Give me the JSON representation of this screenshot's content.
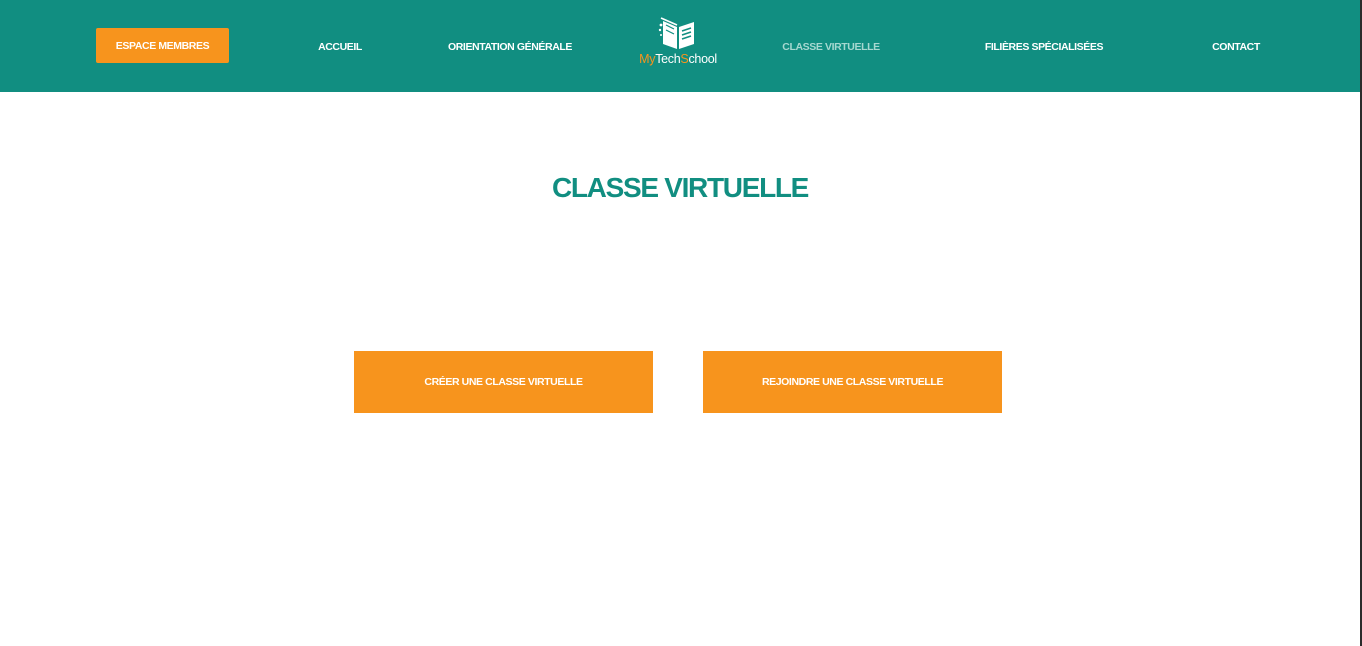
{
  "header": {
    "background": "#118e81",
    "members_button": "ESPACE MEMBRES",
    "nav": {
      "home": "ACCUEIL",
      "orientation": "ORIENTATION GÉNÉRALE",
      "virtual_class": "CLASSE VIRTUELLE",
      "specialized": "FILIÈRES SPÉCIALISÉES",
      "contact": "CONTACT"
    },
    "active_item": "CLASSE VIRTUELLE",
    "logo": {
      "icon": "book-icon",
      "my": "My",
      "tech": "Tech",
      "s": "S",
      "chool": "chool"
    }
  },
  "main": {
    "title": "CLASSE VIRTUELLE",
    "create_button": "CRÉER UNE CLASSE VIRTUELLE",
    "join_button": "REJOINDRE UNE CLASSE VIRTUELLE"
  },
  "colors": {
    "accent": "#f7941d",
    "brand": "#118e81",
    "active_nav": "#a6d8d0"
  }
}
